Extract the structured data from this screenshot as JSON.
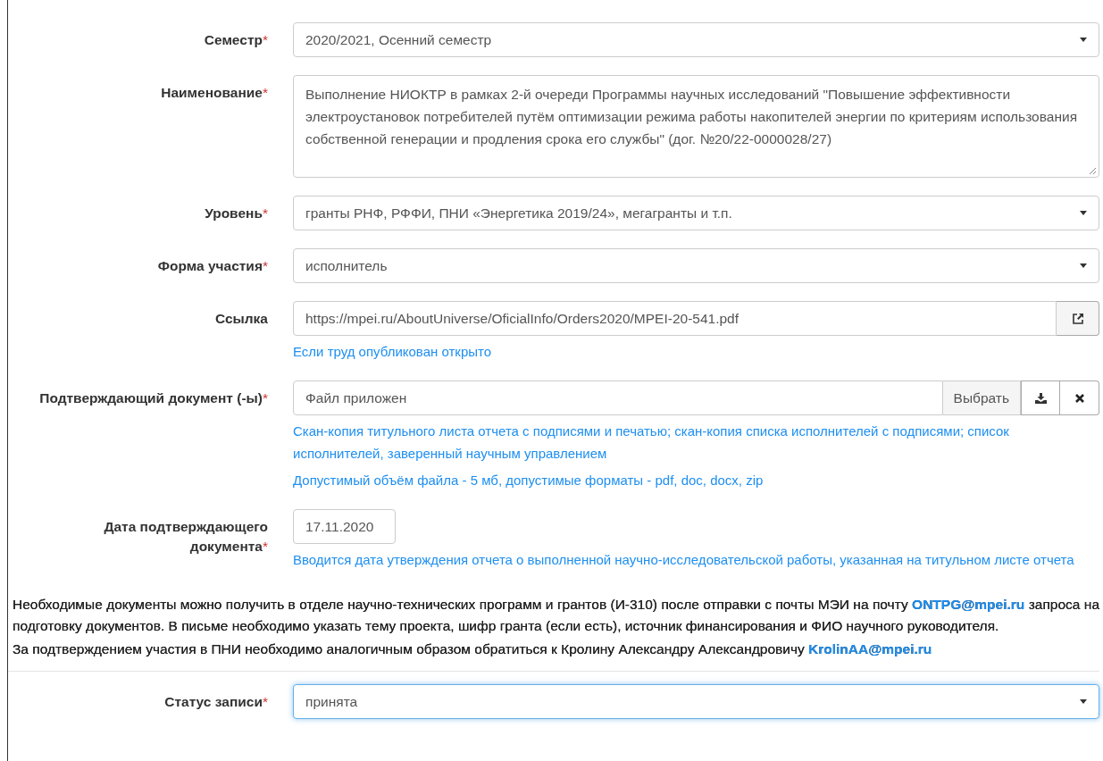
{
  "fields": [
    {
      "kind": "select",
      "label": "Семестр",
      "required_mark": "*",
      "value": "2020/2021, Осенний семестр",
      "focused": false
    },
    {
      "kind": "textarea",
      "label": "Наименование",
      "required_mark": "*",
      "value": "Выполнение НИОКТР в рамках 2-й очереди Программы научных исследований \"Повышение эффективности электроустановок потребителей путём оптимизации режима работы накопителей энергии по критериям использования собственной генерации и продления срока его службы\" (дог. №20/22-0000028/27)"
    },
    {
      "kind": "select",
      "label": "Уровень",
      "required_mark": "*",
      "value": "гранты РНФ, РФФИ, ПНИ «Энергетика 2019/24», мегагранты и т.п.",
      "focused": false
    },
    {
      "kind": "select",
      "label": "Форма участия",
      "required_mark": "*",
      "value": "исполнитель",
      "focused": false
    },
    {
      "kind": "url",
      "label": "Ссылка",
      "value": "https://mpei.ru/AboutUniverse/OficialInfo/Orders2020/MPEI-20-541.pdf",
      "help": [
        "Если труд опубликован открыто"
      ]
    },
    {
      "kind": "file",
      "label": "Подтверждающий документ (-ы)",
      "required_mark": "*",
      "value": "Файл приложен",
      "button": "Выбрать",
      "help": [
        "Скан-копия титульного листа отчета с подписями и печатью; скан-копия списка исполнителей с подписями; список исполнителей, заверенный научным управлением",
        "Допустимый объём файла - 5 мб, допустимые форматы - pdf, doc, docx, zip"
      ]
    },
    {
      "kind": "date",
      "label": "Дата подтверждающего документа",
      "required_mark": "*",
      "value": "17.11.2020",
      "help": [
        "Вводится дата утверждения отчета о выполненной научно-исследовательской работы, указанная на титульном листе отчета"
      ]
    }
  ],
  "note": [
    [
      {
        "kind": "text",
        "text": "Необходимые документы можно получить в отделе научно-технических программ и грантов (И-310) после отправки с почты МЭИ на почту"
      },
      {
        "kind": "link",
        "text": "ONTPG@mpei.ru"
      },
      {
        "kind": "text",
        "text": "запроса на подготовку документов. В письме необходимо указать тему проекта, шифр гранта (если есть), источник финансирования и ФИО научного руководителя."
      }
    ],
    [
      {
        "kind": "text",
        "text": "За подтверждением участия в ПНИ необходимо аналогичным образом обратиться к Кролину Александру Александровичу"
      },
      {
        "kind": "link",
        "text": "KrolinAA@mpei.ru"
      }
    ]
  ],
  "status": {
    "kind": "select",
    "label": "Статус записи",
    "required_mark": "*",
    "value": "принята",
    "focused": true
  }
}
